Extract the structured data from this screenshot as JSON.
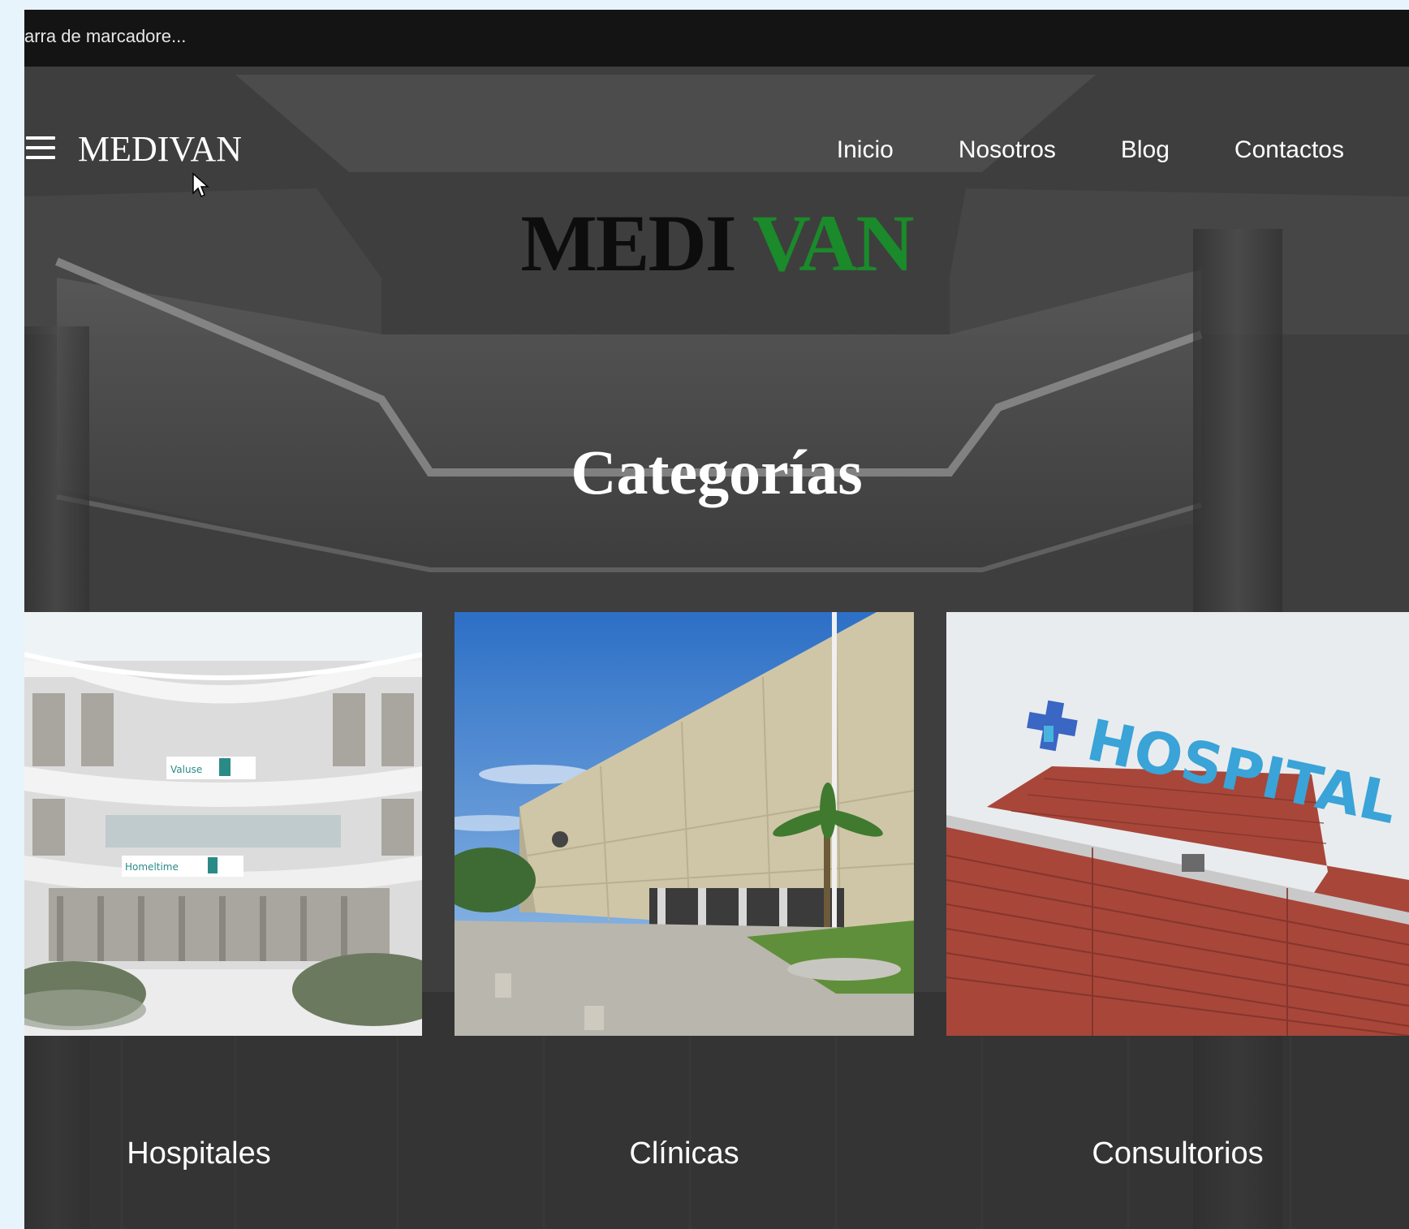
{
  "browser": {
    "bookmarks_bar_text": "arra de marcadore..."
  },
  "header": {
    "brand": "MEDIVAN",
    "nav": [
      "Inicio",
      "Nosotros",
      "Blog",
      "Contactos"
    ]
  },
  "hero": {
    "logo_dark": "MEDI",
    "logo_green": "VAN",
    "title": "Categorías"
  },
  "categories": [
    {
      "label": "Hospitales"
    },
    {
      "label": "Clínicas"
    },
    {
      "label": "Consultorios"
    }
  ],
  "signs": {
    "hospital_sign": "HOSPITAL",
    "interior_sign_1": "Valuse",
    "interior_sign_2": "Homeltime"
  },
  "colors": {
    "logo_dark": "#0d0d0d",
    "logo_green": "#1a8a2a",
    "sign_blue": "#3aa3d8",
    "brick": "#a8463a"
  }
}
